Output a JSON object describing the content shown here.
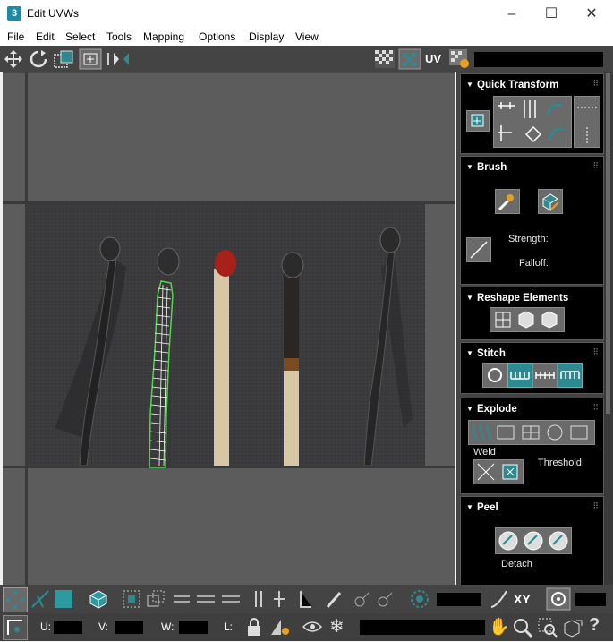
{
  "window": {
    "app_icon_text": "3",
    "title": "Edit UVWs",
    "minimize": "–",
    "maximize": "☐",
    "close": "✕"
  },
  "menu": [
    "File",
    "Edit",
    "Select",
    "Tools",
    "Mapping",
    "Options",
    "Display",
    "View"
  ],
  "toolbar": {
    "uv_label": "UV"
  },
  "panel": {
    "quick_transform": {
      "title": "Quick Transform"
    },
    "brush": {
      "title": "Brush",
      "strength_label": "Strength:",
      "falloff_label": "Falloff:"
    },
    "reshape": {
      "title": "Reshape Elements"
    },
    "stitch": {
      "title": "Stitch"
    },
    "explode": {
      "title": "Explode",
      "weld_label": "Weld",
      "threshold_label": "Threshold:"
    },
    "peel": {
      "title": "Peel",
      "detach_label": "Detach"
    }
  },
  "bottom": {
    "xy_label": "XY",
    "u_label": "U:",
    "v_label": "V:",
    "w_label": "W:",
    "l_label": "L:"
  },
  "colors": {
    "accent": "#2d8a90",
    "panel_bg": "#444444",
    "viewport_bg": "#5c5c5c",
    "uv_green": "#4cd94c"
  }
}
